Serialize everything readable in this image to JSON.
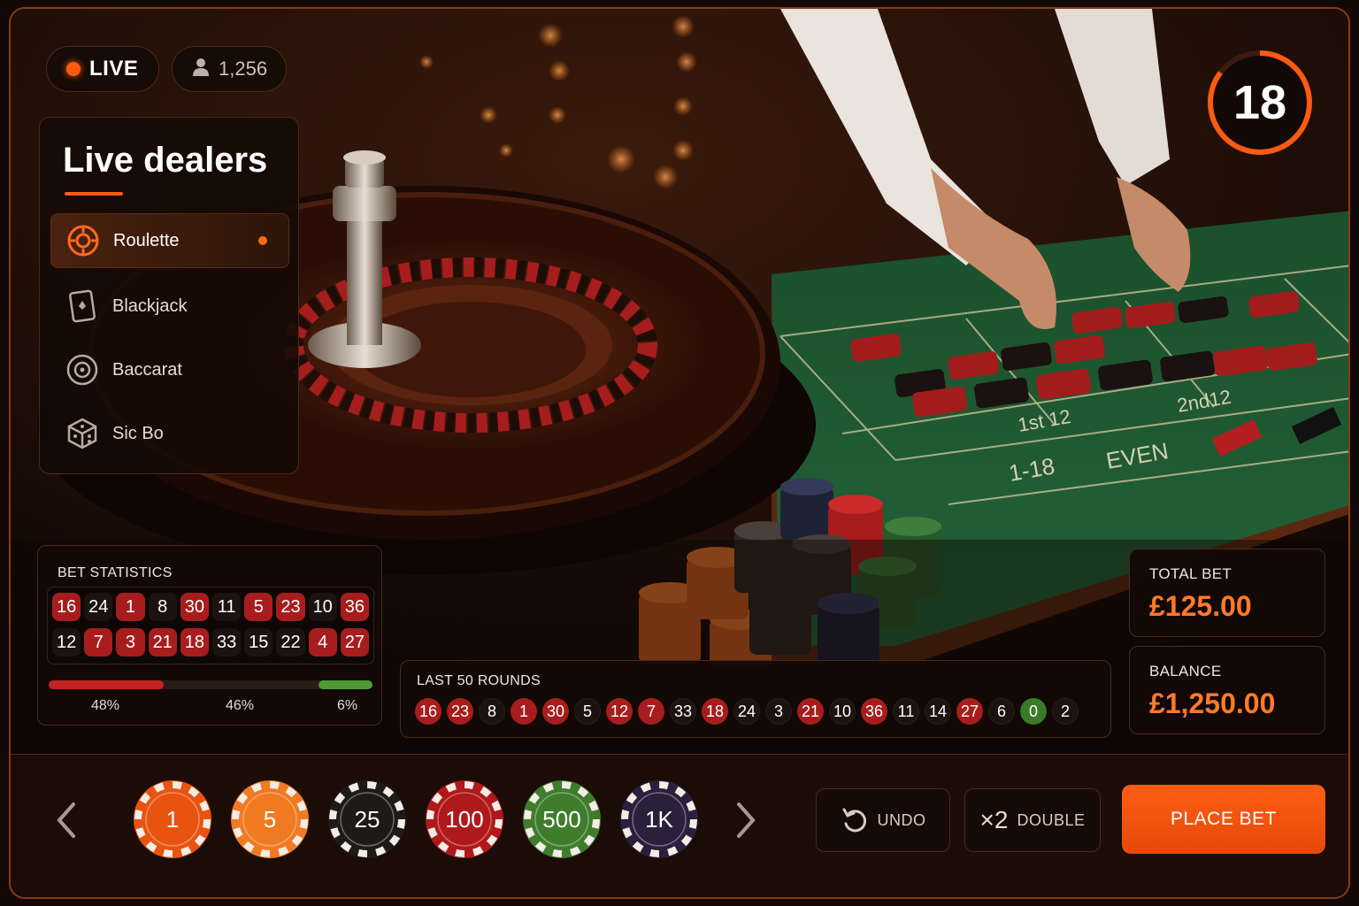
{
  "header": {
    "live_label": "LIVE",
    "viewer_count": "1,256",
    "timer": "18"
  },
  "sidebar": {
    "title": "Live dealers",
    "items": [
      {
        "label": "Roulette",
        "icon": "roulette-icon",
        "active": true
      },
      {
        "label": "Blackjack",
        "icon": "card-icon",
        "active": false
      },
      {
        "label": "Baccarat",
        "icon": "baccarat-icon",
        "active": false
      },
      {
        "label": "Sic Bo",
        "icon": "dice-icon",
        "active": false
      }
    ]
  },
  "stats": {
    "title": "BET STATISTICS",
    "numbers": [
      {
        "n": "16",
        "c": "red"
      },
      {
        "n": "24",
        "c": "black"
      },
      {
        "n": "1",
        "c": "red"
      },
      {
        "n": "8",
        "c": "black"
      },
      {
        "n": "30",
        "c": "red"
      },
      {
        "n": "11",
        "c": "black"
      },
      {
        "n": "5",
        "c": "red"
      },
      {
        "n": "23",
        "c": "red"
      },
      {
        "n": "10",
        "c": "black"
      },
      {
        "n": "36",
        "c": "red"
      },
      {
        "n": "12",
        "c": "black"
      },
      {
        "n": "7",
        "c": "red"
      },
      {
        "n": "3",
        "c": "red"
      },
      {
        "n": "21",
        "c": "red"
      },
      {
        "n": "18",
        "c": "red"
      },
      {
        "n": "33",
        "c": "black"
      },
      {
        "n": "15",
        "c": "black"
      },
      {
        "n": "22",
        "c": "black"
      },
      {
        "n": "4",
        "c": "red"
      },
      {
        "n": "27",
        "c": "red"
      }
    ],
    "red_pct_label": "48%",
    "black_pct_label": "46%",
    "green_pct_label": "6%",
    "red_fraction": 0.48,
    "black_fraction": 0.46,
    "green_fraction": 0.06
  },
  "rounds": {
    "title": "LAST 50 ROUNDS",
    "numbers": [
      {
        "n": "16",
        "c": "red"
      },
      {
        "n": "23",
        "c": "red"
      },
      {
        "n": "8",
        "c": "black"
      },
      {
        "n": "1",
        "c": "red"
      },
      {
        "n": "30",
        "c": "red"
      },
      {
        "n": "5",
        "c": "black"
      },
      {
        "n": "12",
        "c": "red"
      },
      {
        "n": "7",
        "c": "red"
      },
      {
        "n": "33",
        "c": "black"
      },
      {
        "n": "18",
        "c": "red"
      },
      {
        "n": "24",
        "c": "black"
      },
      {
        "n": "3",
        "c": "black"
      },
      {
        "n": "21",
        "c": "red"
      },
      {
        "n": "10",
        "c": "black"
      },
      {
        "n": "36",
        "c": "red"
      },
      {
        "n": "11",
        "c": "black"
      },
      {
        "n": "14",
        "c": "black"
      },
      {
        "n": "27",
        "c": "red"
      },
      {
        "n": "6",
        "c": "black"
      },
      {
        "n": "0",
        "c": "green"
      },
      {
        "n": "2",
        "c": "black"
      }
    ]
  },
  "totals": {
    "total_bet_label": "TOTAL BET",
    "total_bet_value": "£125.00",
    "balance_label": "BALANCE",
    "balance_value": "£1,250.00"
  },
  "table_labels": {
    "dozen_1": "1st 12",
    "dozen_2": "2nd12",
    "low": "1-18",
    "even": "EVEN"
  },
  "chips": [
    {
      "label": "1",
      "color": "#e8540f"
    },
    {
      "label": "5",
      "color": "#f07a22"
    },
    {
      "label": "25",
      "color": "#1e1a18"
    },
    {
      "label": "100",
      "color": "#b0191b"
    },
    {
      "label": "500",
      "color": "#3f7d2c"
    },
    {
      "label": "1K",
      "color": "#2a1f3d"
    }
  ],
  "controls": {
    "undo_label": "UNDO",
    "double_prefix": "×2",
    "double_label": "DOUBLE",
    "place_bet_label": "PLACE BET"
  },
  "colors": {
    "accent": "#ff5a12",
    "red": "#a71d1d",
    "black": "#1c1310",
    "green": "#3a7a2a",
    "felt": "#1f5a33"
  }
}
